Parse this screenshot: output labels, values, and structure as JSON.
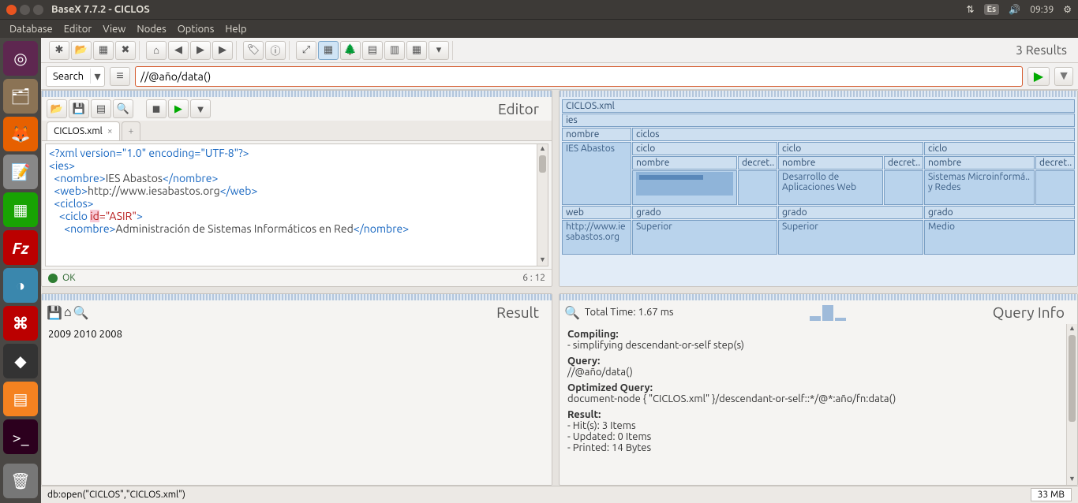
{
  "sysbar": {
    "title": "BaseX 7.7.2 - CICLOS",
    "lang": "Es",
    "time": "09:39"
  },
  "menu": {
    "database": "Database",
    "editor": "Editor",
    "view": "View",
    "nodes": "Nodes",
    "options": "Options",
    "help": "Help"
  },
  "toolbar": {
    "results": "3 Results"
  },
  "search": {
    "mode": "Search",
    "query": "//@año/data()"
  },
  "editor": {
    "title": "Editor",
    "tab": "CICLOS.xml",
    "status": "OK",
    "pos": "6 : 12",
    "code": {
      "decl": "<?xml version=\"1.0\" encoding=\"UTF-8\"?>",
      "l2": "<ies>",
      "l3a": "  <nombre>",
      "l3b": "IES Abastos",
      "l3c": "</nombre>",
      "l4a": "  <web>",
      "l4b": "http://www.iesabastos.org",
      "l4c": "</web>",
      "l5": "  <ciclos>",
      "l6a": "    <ciclo ",
      "l6b": "id",
      "l6c": "=\"ASIR\"",
      "l6d": ">",
      "l7a": "      <nombre>",
      "l7b": "Administración de Sistemas Informáticos en Red",
      "l7c": "</nombre>"
    }
  },
  "viz": {
    "file": "CICLOS.xml",
    "root": "ies",
    "nombre": "nombre",
    "ciclos": "ciclos",
    "ciclo": "ciclo",
    "iesName": "IES Abastos",
    "decret": "decret..",
    "grado": "grado",
    "superior": "Superior",
    "medio": "Medio",
    "weblbl": "web",
    "weburl": "http://www.iesabastos.org",
    "c1name": "Desarrollo de Aplicaciones Web",
    "c2name": "Sistemas Microinformá.. y Redes"
  },
  "result": {
    "title": "Result",
    "text": "2009  2010  2008"
  },
  "qinfo": {
    "title": "Query Info",
    "total": "Total Time: 1.67 ms",
    "compilingHdr": "Compiling:",
    "compiling1": "- simplifying descendant-or-self step(s)",
    "queryHdr": "Query:",
    "query1": "//@año/data()",
    "optHdr": "Optimized Query:",
    "opt1": "document-node { \"CICLOS.xml\" }/descendant-or-self::*/@*:año/fn:data()",
    "resHdr": "Result:",
    "res1": "- Hit(s): 3 Items",
    "res2": "- Updated: 0 Items",
    "res3": "- Printed: 14 Bytes"
  },
  "statusbar": {
    "text": "db:open(\"CICLOS\",\"CICLOS.xml\")",
    "mem": "33 MB"
  }
}
